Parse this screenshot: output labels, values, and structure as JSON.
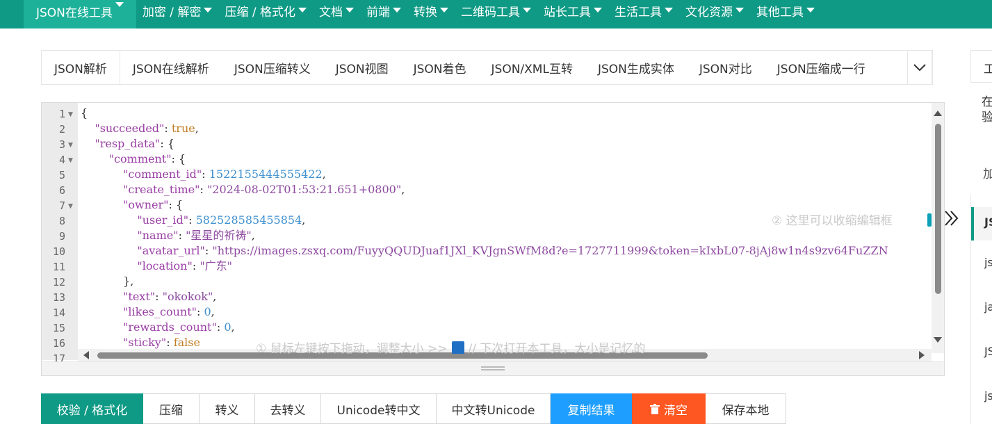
{
  "nav": {
    "items": [
      {
        "label": "JSON在线工具",
        "active": true
      },
      {
        "label": "加密 / 解密"
      },
      {
        "label": "压缩 / 格式化"
      },
      {
        "label": "文档"
      },
      {
        "label": "前端"
      },
      {
        "label": "转换"
      },
      {
        "label": "二维码工具"
      },
      {
        "label": "站长工具"
      },
      {
        "label": "生活工具"
      },
      {
        "label": "文化资源"
      },
      {
        "label": "其他工具"
      }
    ]
  },
  "tabs": [
    "JSON解析",
    "JSON在线解析",
    "JSON压缩转义",
    "JSON视图",
    "JSON着色",
    "JSON/XML互转",
    "JSON生成实体",
    "JSON对比",
    "JSON压缩成一行"
  ],
  "editor": {
    "line_numbers": [
      "1",
      "2",
      "3",
      "4",
      "5",
      "6",
      "7",
      "8",
      "9",
      "10",
      "11",
      "12",
      "13",
      "14",
      "15",
      "16",
      "17"
    ],
    "foldable_lines": [
      "1",
      "3",
      "4",
      "7"
    ],
    "lines": [
      {
        "indent": "",
        "parts": [
          [
            "p",
            "{"
          ]
        ]
      },
      {
        "indent": "    ",
        "parts": [
          [
            "k",
            "\"succeeded\""
          ],
          [
            "p",
            ": "
          ],
          [
            "b",
            "true"
          ],
          [
            "p",
            ","
          ]
        ]
      },
      {
        "indent": "    ",
        "parts": [
          [
            "k",
            "\"resp_data\""
          ],
          [
            "p",
            ": {"
          ]
        ]
      },
      {
        "indent": "        ",
        "parts": [
          [
            "k",
            "\"comment\""
          ],
          [
            "p",
            ": {"
          ]
        ]
      },
      {
        "indent": "            ",
        "parts": [
          [
            "k",
            "\"comment_id\""
          ],
          [
            "p",
            ": "
          ],
          [
            "n",
            "1522155444555422"
          ],
          [
            "p",
            ","
          ]
        ]
      },
      {
        "indent": "            ",
        "parts": [
          [
            "k",
            "\"create_time\""
          ],
          [
            "p",
            ": "
          ],
          [
            "s",
            "\"2024-08-02T01:53:21.651+0800\""
          ],
          [
            "p",
            ","
          ]
        ]
      },
      {
        "indent": "            ",
        "parts": [
          [
            "k",
            "\"owner\""
          ],
          [
            "p",
            ": {"
          ]
        ]
      },
      {
        "indent": "                ",
        "parts": [
          [
            "k",
            "\"user_id\""
          ],
          [
            "p",
            ": "
          ],
          [
            "n",
            "582528585455854"
          ],
          [
            "p",
            ","
          ]
        ]
      },
      {
        "indent": "                ",
        "parts": [
          [
            "k",
            "\"name\""
          ],
          [
            "p",
            ": "
          ],
          [
            "s",
            "\"星星的祈祷\""
          ],
          [
            "p",
            ","
          ]
        ]
      },
      {
        "indent": "                ",
        "parts": [
          [
            "k",
            "\"avatar_url\""
          ],
          [
            "p",
            ": "
          ],
          [
            "s",
            "\"https://images.zsxq.com/FuyyQQUDJuaf1JXl_KVJgnSWfM8d?e=1727711999&token=kIxbL07-8jAj8w1n4s9zv64FuZZN"
          ]
        ]
      },
      {
        "indent": "                ",
        "parts": [
          [
            "k",
            "\"location\""
          ],
          [
            "p",
            ": "
          ],
          [
            "s",
            "\"广东\""
          ]
        ]
      },
      {
        "indent": "            ",
        "parts": [
          [
            "p",
            "},"
          ]
        ]
      },
      {
        "indent": "            ",
        "parts": [
          [
            "k",
            "\"text\""
          ],
          [
            "p",
            ": "
          ],
          [
            "s",
            "\"okokok\""
          ],
          [
            "p",
            ","
          ]
        ]
      },
      {
        "indent": "            ",
        "parts": [
          [
            "k",
            "\"likes_count\""
          ],
          [
            "p",
            ": "
          ],
          [
            "n",
            "0"
          ],
          [
            "p",
            ","
          ]
        ]
      },
      {
        "indent": "            ",
        "parts": [
          [
            "k",
            "\"rewards_count\""
          ],
          [
            "p",
            ": "
          ],
          [
            "n",
            "0"
          ],
          [
            "p",
            ","
          ]
        ]
      },
      {
        "indent": "            ",
        "parts": [
          [
            "k",
            "\"sticky\""
          ],
          [
            "p",
            ": "
          ],
          [
            "b",
            "false"
          ]
        ]
      }
    ],
    "hint_resize": "① 鼠标左键按下拖动，调整大小 >>",
    "hint_remember": "// 下次打开本工具，大小是记忆的",
    "hint_collapse": "② 这里可以收缩编辑框"
  },
  "buttons": {
    "validate": "校验 / 格式化",
    "compress": "压缩",
    "escape": "转义",
    "unescape": "去转义",
    "unicode_to_cn": "Unicode转中文",
    "cn_to_unicode": "中文转Unicode",
    "copy": "复制结果",
    "clear": "清空",
    "save": "保存本地"
  },
  "right_panel": {
    "head": "工",
    "text": "在验",
    "add": "加",
    "items": [
      "JS",
      "js",
      "ja",
      "JS",
      "js"
    ]
  },
  "colors": {
    "nav_bg": "#0f9a85",
    "primary": "#0f9a85",
    "copy_btn": "#1e9fff",
    "clear_btn": "#ff5722"
  }
}
